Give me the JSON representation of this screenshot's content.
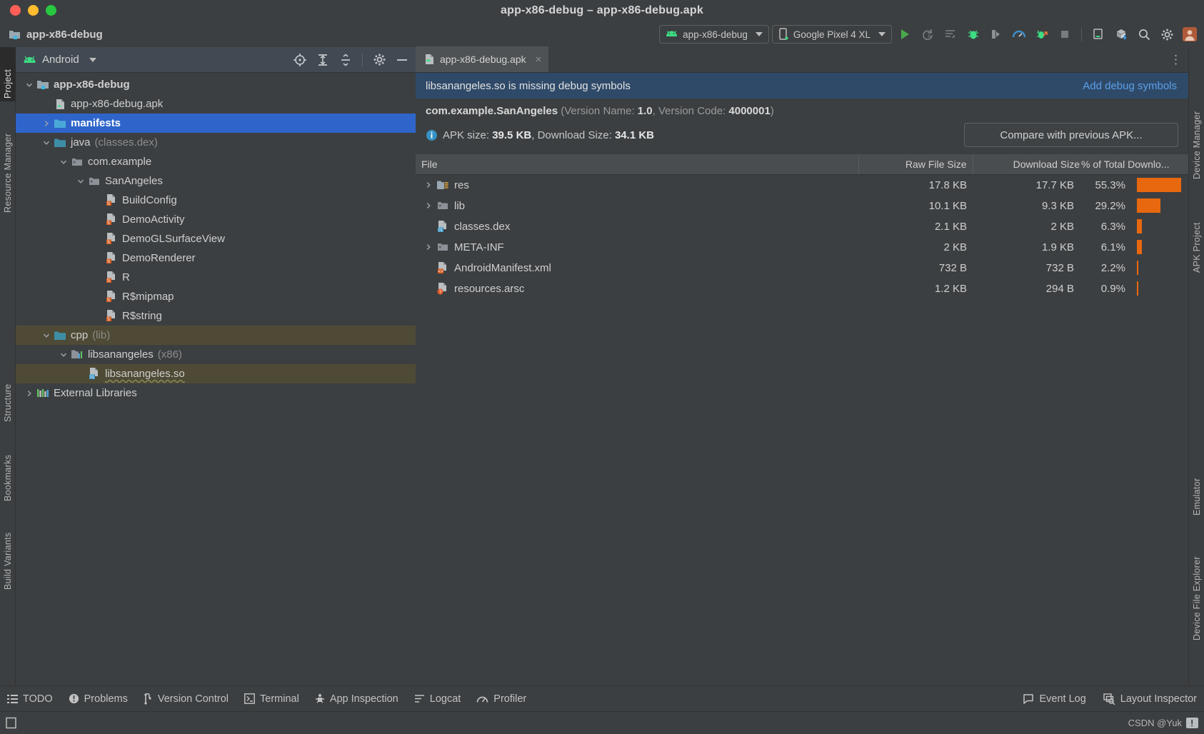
{
  "window": {
    "title": "app-x86-debug – app-x86-debug.apk",
    "traffic_lights": [
      "close",
      "minimize",
      "zoom"
    ]
  },
  "navbar": {
    "breadcrumb": "app-x86-debug",
    "run_config": "app-x86-debug",
    "device": "Google Pixel 4 XL",
    "icons": [
      "run-icon",
      "apply-changes-icon",
      "apply-code-changes-icon",
      "debug-icon",
      "attach-debugger-icon",
      "profiler-icon",
      "debug-native-icon",
      "stop-icon",
      "device-manager-icon",
      "sdk-manager-icon",
      "search-icon",
      "settings-icon",
      "avatar-icon"
    ]
  },
  "left_strip": [
    {
      "label": "Project",
      "active": true
    },
    {
      "label": "Resource Manager",
      "active": false
    },
    {
      "label": "Structure",
      "active": false
    },
    {
      "label": "Bookmarks",
      "active": false
    },
    {
      "label": "Build Variants",
      "active": false
    }
  ],
  "right_strip": [
    {
      "label": "Device Manager"
    },
    {
      "label": "APK Project"
    },
    {
      "label": "Emulator"
    },
    {
      "label": "Device File Explorer"
    }
  ],
  "project_panel": {
    "view_name": "Android",
    "header_icons": [
      "select-opened-file-icon",
      "expand-all-icon",
      "collapse-all-icon",
      "settings-icon",
      "hide-icon"
    ],
    "tree": [
      {
        "depth": 0,
        "arrow": "down",
        "icon": "module-folder-icon",
        "label": "app-x86-debug",
        "suffix": "",
        "state": "bold"
      },
      {
        "depth": 1,
        "arrow": "none",
        "icon": "apk-file-icon",
        "label": "app-x86-debug.apk",
        "suffix": "",
        "state": ""
      },
      {
        "depth": 1,
        "arrow": "right",
        "icon": "folder-blue-icon",
        "label": "manifests",
        "suffix": "",
        "state": "selected"
      },
      {
        "depth": 1,
        "arrow": "down",
        "icon": "folder-teal-icon",
        "label": "java",
        "suffix": "(classes.dex)",
        "state": ""
      },
      {
        "depth": 2,
        "arrow": "down",
        "icon": "package-icon",
        "label": "com.example",
        "suffix": "",
        "state": ""
      },
      {
        "depth": 3,
        "arrow": "down",
        "icon": "package-icon",
        "label": "SanAngeles",
        "suffix": "",
        "state": ""
      },
      {
        "depth": 4,
        "arrow": "none",
        "icon": "smali-class-icon",
        "label": "BuildConfig",
        "suffix": "",
        "state": ""
      },
      {
        "depth": 4,
        "arrow": "none",
        "icon": "smali-class-icon",
        "label": "DemoActivity",
        "suffix": "",
        "state": ""
      },
      {
        "depth": 4,
        "arrow": "none",
        "icon": "smali-class-icon",
        "label": "DemoGLSurfaceView",
        "suffix": "",
        "state": ""
      },
      {
        "depth": 4,
        "arrow": "none",
        "icon": "smali-class-icon",
        "label": "DemoRenderer",
        "suffix": "",
        "state": ""
      },
      {
        "depth": 4,
        "arrow": "none",
        "icon": "smali-class-icon",
        "label": "R",
        "suffix": "",
        "state": ""
      },
      {
        "depth": 4,
        "arrow": "none",
        "icon": "smali-class-icon",
        "label": "R$mipmap",
        "suffix": "",
        "state": ""
      },
      {
        "depth": 4,
        "arrow": "none",
        "icon": "smali-class-icon",
        "label": "R$string",
        "suffix": "",
        "state": ""
      },
      {
        "depth": 1,
        "arrow": "down",
        "icon": "folder-teal-icon",
        "label": "cpp",
        "suffix": "(lib)",
        "state": "highlight"
      },
      {
        "depth": 2,
        "arrow": "down",
        "icon": "native-lib-icon",
        "label": "libsanangeles",
        "suffix": "(x86)",
        "state": ""
      },
      {
        "depth": 3,
        "arrow": "none",
        "icon": "binary-file-icon",
        "label": "libsanangeles.so",
        "suffix": "",
        "state": "highlight-wave"
      },
      {
        "depth": 0,
        "arrow": "right",
        "icon": "external-libs-icon",
        "label": "External Libraries",
        "suffix": "",
        "state": ""
      }
    ]
  },
  "editor": {
    "tab": {
      "label": "app-x86-debug.apk",
      "icon": "apk-file-icon",
      "close": "×"
    },
    "more_icon": "more-options-icon",
    "banner": {
      "message": "libsanangeles.so is missing debug symbols",
      "action": "Add debug symbols"
    },
    "package": {
      "name": "com.example.SanAngeles",
      "version_name_label": "(Version Name:",
      "version_name": "1.0",
      "version_code_label": ", Version Code:",
      "version_code": "4000001",
      "closing": ")"
    },
    "size_info": {
      "icon": "info-icon",
      "apk_size_label": "APK size:",
      "apk_size": "39.5 KB",
      "download_size_label": ", Download Size:",
      "download_size": "34.1 KB",
      "compare_button": "Compare with previous APK..."
    },
    "table": {
      "columns": [
        "File",
        "Raw File Size",
        "Download Size",
        "% of Total Downlo..."
      ],
      "rows": [
        {
          "arrow": "right",
          "icon": "folder-res-icon",
          "name": "res",
          "raw": "17.8 KB",
          "download": "17.7 KB",
          "pct": "55.3%",
          "pct_value": 55.3
        },
        {
          "arrow": "right",
          "icon": "folder-archive-icon",
          "name": "lib",
          "raw": "10.1 KB",
          "download": "9.3 KB",
          "pct": "29.2%",
          "pct_value": 29.2
        },
        {
          "arrow": "none",
          "icon": "binary-file-icon",
          "name": "classes.dex",
          "raw": "2.1 KB",
          "download": "2 KB",
          "pct": "6.3%",
          "pct_value": 6.3
        },
        {
          "arrow": "right",
          "icon": "folder-archive-icon",
          "name": "META-INF",
          "raw": "2 KB",
          "download": "1.9 KB",
          "pct": "6.1%",
          "pct_value": 6.1
        },
        {
          "arrow": "none",
          "icon": "xml-file-icon",
          "name": "AndroidManifest.xml",
          "raw": "732 B",
          "download": "732 B",
          "pct": "2.2%",
          "pct_value": 2.2
        },
        {
          "arrow": "none",
          "icon": "arsc-file-icon",
          "name": "resources.arsc",
          "raw": "1.2 KB",
          "download": "294 B",
          "pct": "0.9%",
          "pct_value": 0.9
        }
      ]
    }
  },
  "bottom_bar": {
    "left": [
      {
        "label": "TODO",
        "icon": "todo-icon"
      },
      {
        "label": "Problems",
        "icon": "problems-icon"
      },
      {
        "label": "Version Control",
        "icon": "vcs-icon"
      },
      {
        "label": "Terminal",
        "icon": "terminal-icon"
      },
      {
        "label": "App Inspection",
        "icon": "app-inspection-icon"
      },
      {
        "label": "Logcat",
        "icon": "logcat-icon"
      },
      {
        "label": "Profiler",
        "icon": "profiler-icon"
      }
    ],
    "right": [
      {
        "label": "Event Log",
        "icon": "event-log-icon"
      },
      {
        "label": "Layout Inspector",
        "icon": "layout-inspector-icon"
      }
    ]
  },
  "status_bar": {
    "left_icon": "memory-indicator-icon",
    "watermark": "CSDN @Yuk"
  },
  "colors": {
    "window_bg": "#3c3f41",
    "panel_header": "#414a52",
    "selection_blue": "#2f65ca",
    "banner_blue": "#2f4a69",
    "link_blue": "#5b9fe8",
    "highlight_olive": "#4e4a35",
    "bar_orange": "#e8680f",
    "table_header": "#4a4d4f"
  }
}
